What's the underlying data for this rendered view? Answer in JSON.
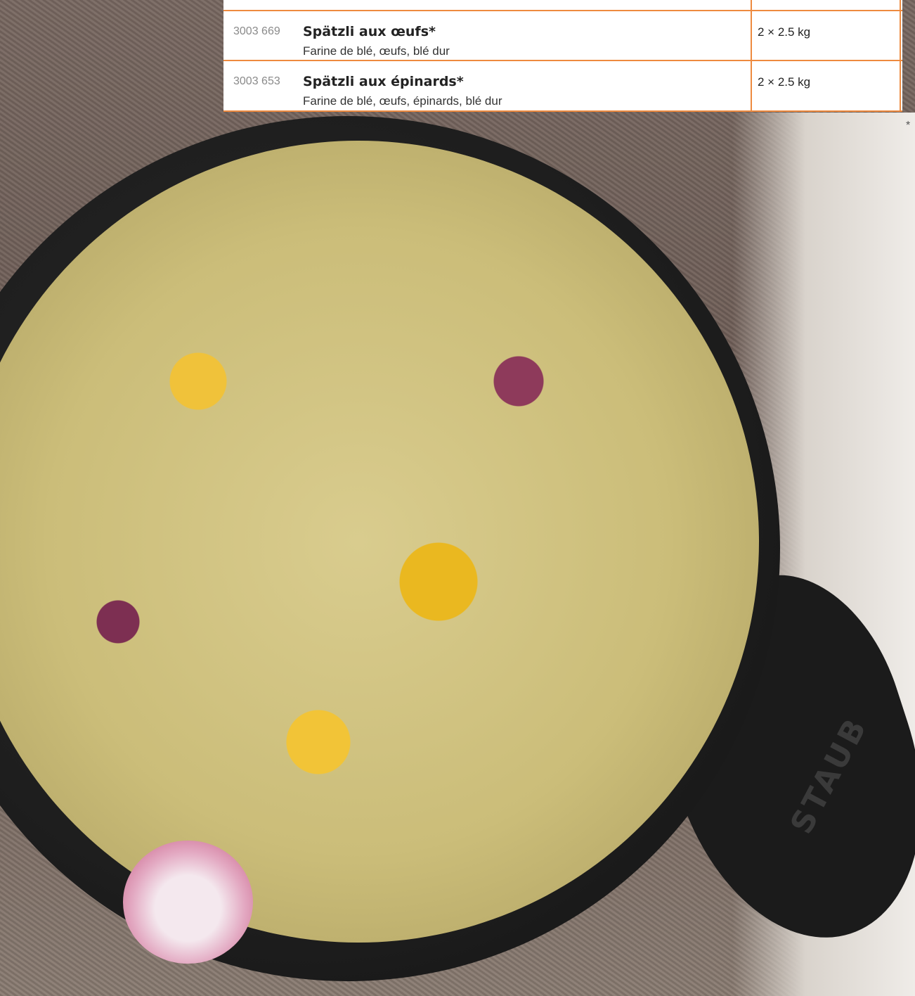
{
  "products": [
    {
      "code": "3003 669",
      "name": "Spätzli aux œufs*",
      "description": "Farine de blé, œufs, blé dur",
      "packaging": "2 × 2.5 kg"
    },
    {
      "code": "3003 653",
      "name": "Spätzli aux épinards*",
      "description": "Farine de blé, œufs, épinards, blé dur",
      "packaging": "2 × 2.5 kg"
    }
  ],
  "footnote_mark": "*",
  "pan_brand": "STAUB",
  "colors": {
    "table_border": "#ee8a3f"
  }
}
